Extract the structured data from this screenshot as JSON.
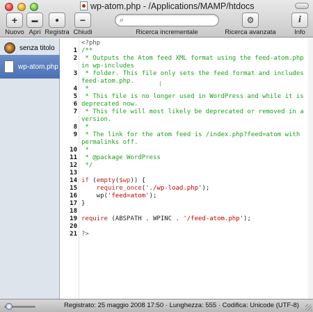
{
  "window": {
    "title": "wp-atom.php - /Applications/MAMP/htdocs"
  },
  "toolbar": {
    "buttons": [
      {
        "label": "Nuovo",
        "glyph": "+"
      },
      {
        "label": "Apri",
        "glyph": "▬"
      },
      {
        "label": "Registra",
        "glyph": "●"
      },
      {
        "label": "Chiudi",
        "glyph": "−"
      }
    ],
    "search": {
      "label": "Ricerca incrementale",
      "value": "",
      "glyph": "⌕"
    },
    "advanced": {
      "label": "Ricerca avanzata",
      "glyph": "⚙"
    },
    "info": {
      "label": "Info",
      "glyph": "i"
    }
  },
  "sidebar": {
    "items": [
      {
        "label": "senza titolo"
      },
      {
        "label": "wp-atom.php"
      }
    ]
  },
  "editor": {
    "rows": [
      {
        "num": "",
        "parts": [
          {
            "t": "<?php",
            "c": "ph"
          }
        ]
      },
      {
        "num": "1",
        "parts": [
          {
            "t": "/**",
            "c": "cm"
          }
        ]
      },
      {
        "num": "2",
        "parts": [
          {
            "t": " * Outputs the Atom feed XML format using the feed-atom.php file",
            "c": "cm"
          }
        ]
      },
      {
        "num": "",
        "parts": [
          {
            "t": "in wp-includes",
            "c": "cm"
          }
        ]
      },
      {
        "num": "3",
        "parts": [
          {
            "t": " * folder. This file only sets the feed format and includes the",
            "c": "cm"
          }
        ]
      },
      {
        "num": "",
        "parts": [
          {
            "t": "feed-atom.php.",
            "c": "cm"
          }
        ]
      },
      {
        "num": "4",
        "parts": [
          {
            "t": " *",
            "c": "cm"
          }
        ]
      },
      {
        "num": "5",
        "parts": [
          {
            "t": " * This file is no longer used in WordPress and while it is not",
            "c": "cm"
          }
        ]
      },
      {
        "num": "6",
        "parts": [
          {
            "t": "deprecated now.",
            "c": "cm"
          }
        ]
      },
      {
        "num": "7",
        "parts": [
          {
            "t": " * This file will most likely be deprecated or removed in a later",
            "c": "cm"
          }
        ]
      },
      {
        "num": "",
        "parts": [
          {
            "t": "version.",
            "c": "cm"
          }
        ]
      },
      {
        "num": "8",
        "parts": [
          {
            "t": " *",
            "c": "cm"
          }
        ]
      },
      {
        "num": "9",
        "parts": [
          {
            "t": " * The link for the atom feed is /index.php?feed=atom with",
            "c": "cm"
          }
        ]
      },
      {
        "num": "",
        "parts": [
          {
            "t": "permalinks off.",
            "c": "cm"
          }
        ]
      },
      {
        "num": "10",
        "parts": [
          {
            "t": " *",
            "c": "cm"
          }
        ]
      },
      {
        "num": "11",
        "parts": [
          {
            "t": " * @package WordPress",
            "c": "cm"
          }
        ]
      },
      {
        "num": "12",
        "parts": [
          {
            "t": " */",
            "c": "cm"
          }
        ]
      },
      {
        "num": "13",
        "parts": [
          {
            "t": "",
            "c": "tx"
          }
        ]
      },
      {
        "num": "14",
        "parts": [
          {
            "t": "if",
            "c": "kw"
          },
          {
            "t": " (",
            "c": "tx"
          },
          {
            "t": "empty",
            "c": "fn"
          },
          {
            "t": "(",
            "c": "tx"
          },
          {
            "t": "$wp",
            "c": "kw"
          },
          {
            "t": ")) {",
            "c": "tx"
          }
        ]
      },
      {
        "num": "15",
        "parts": [
          {
            "t": "    ",
            "c": "tx"
          },
          {
            "t": "require_once",
            "c": "fn"
          },
          {
            "t": "(",
            "c": "tx"
          },
          {
            "t": "'./wp-load.php'",
            "c": "st"
          },
          {
            "t": ");",
            "c": "tx"
          }
        ]
      },
      {
        "num": "16",
        "parts": [
          {
            "t": "    wp(",
            "c": "tx"
          },
          {
            "t": "'feed=atom'",
            "c": "st"
          },
          {
            "t": ");",
            "c": "tx"
          }
        ]
      },
      {
        "num": "17",
        "parts": [
          {
            "t": "}",
            "c": "tx"
          }
        ]
      },
      {
        "num": "18",
        "parts": [
          {
            "t": "",
            "c": "tx"
          }
        ]
      },
      {
        "num": "19",
        "parts": [
          {
            "t": "require",
            "c": "fn"
          },
          {
            "t": " (ABSPATH . WPINC . ",
            "c": "tx"
          },
          {
            "t": "'/feed-atom.php'",
            "c": "st"
          },
          {
            "t": ");",
            "c": "tx"
          }
        ]
      },
      {
        "num": "20",
        "parts": [
          {
            "t": "",
            "c": "tx"
          }
        ]
      },
      {
        "num": "21",
        "parts": [
          {
            "t": "?>",
            "c": "ph"
          }
        ]
      }
    ]
  },
  "statusbar": {
    "text": "Registrato: 25 maggio 2008 17:50  ·  Lunghezza: 555  ·  Codifica: Unicode (UTF-8)"
  },
  "colors": {
    "comment": "#1fa01f",
    "keyword": "#c0392b",
    "string": "#c00000",
    "selection": "#5479be"
  }
}
